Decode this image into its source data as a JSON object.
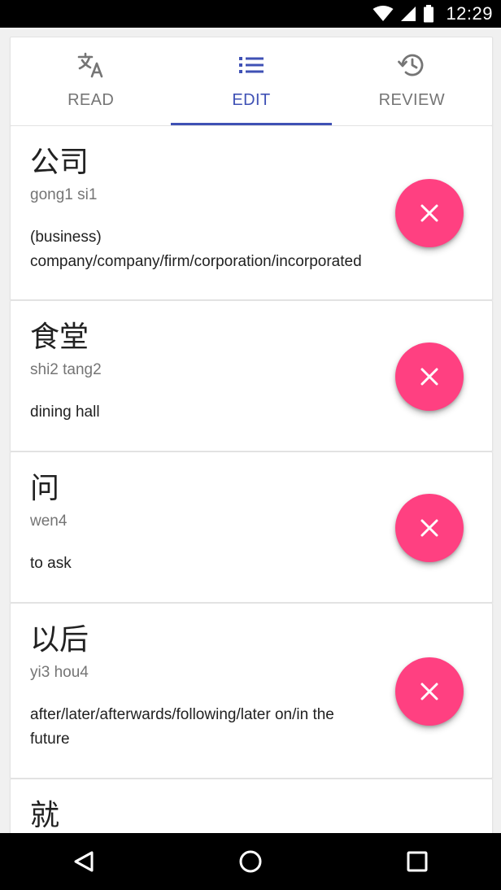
{
  "status_bar": {
    "time": "12:29"
  },
  "tabs": [
    {
      "label": "READ",
      "icon": "translate-icon",
      "active": false
    },
    {
      "label": "EDIT",
      "icon": "list-icon",
      "active": true
    },
    {
      "label": "REVIEW",
      "icon": "history-icon",
      "active": false
    }
  ],
  "entries": [
    {
      "hanzi": "公司",
      "pinyin": "gong1 si1",
      "definition": "(business) company/company/firm/corporation/incorporated"
    },
    {
      "hanzi": "食堂",
      "pinyin": "shi2 tang2",
      "definition": "dining hall"
    },
    {
      "hanzi": "问",
      "pinyin": "wen4",
      "definition": "to ask"
    },
    {
      "hanzi": "以后",
      "pinyin": "yi3 hou4",
      "definition": "after/later/afterwards/following/later on/in the future"
    },
    {
      "hanzi": "就",
      "pinyin": "",
      "definition": ""
    }
  ],
  "colors": {
    "primary": "#3f51b5",
    "accent": "#ff4081",
    "inactive_tab": "#757575",
    "background": "#f0f0f0"
  },
  "nav": [
    "back-icon",
    "home-icon",
    "recents-icon"
  ]
}
